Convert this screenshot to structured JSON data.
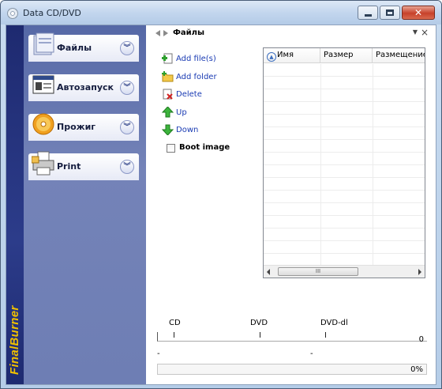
{
  "window": {
    "title": "Data CD/DVD",
    "icon": "disc-icon",
    "controls": [
      "minimize-icon",
      "maximize-icon",
      "close-icon"
    ]
  },
  "sidebar": {
    "brand": "FinalBurner",
    "groups": [
      {
        "label": "Файлы",
        "icon": "files-icon"
      },
      {
        "label": "Автозапуск",
        "icon": "autorun-icon"
      },
      {
        "label": "Прожиг",
        "icon": "burn-disc-icon"
      },
      {
        "label": "Print",
        "icon": "printer-icon"
      }
    ]
  },
  "panel": {
    "title": "Файлы",
    "actions": [
      {
        "label": "Add file(s)",
        "icon": "add-file-icon"
      },
      {
        "label": "Add folder",
        "icon": "add-folder-icon"
      },
      {
        "label": "Delete",
        "icon": "delete-icon"
      },
      {
        "label": "Up",
        "icon": "up-arrow-icon"
      },
      {
        "label": "Down",
        "icon": "down-arrow-icon"
      }
    ],
    "boot_image": {
      "label": "Boot image",
      "checked": false
    }
  },
  "filelist": {
    "columns": [
      "Имя",
      "Размер",
      "Размещение"
    ],
    "rows": [],
    "scrollbar_thumb": "III"
  },
  "capacity": {
    "markers": [
      "CD",
      "DVD",
      "DVD-dl"
    ],
    "size_value": "0",
    "left_status": "-",
    "mid_status": "-",
    "progress_text": "0%",
    "progress_fraction": 0
  },
  "colors": {
    "sidebar_top": "#5568a6",
    "brand_strip": "#1e2a70",
    "brand_text": "#f0c000",
    "link": "#1a3bb3"
  }
}
